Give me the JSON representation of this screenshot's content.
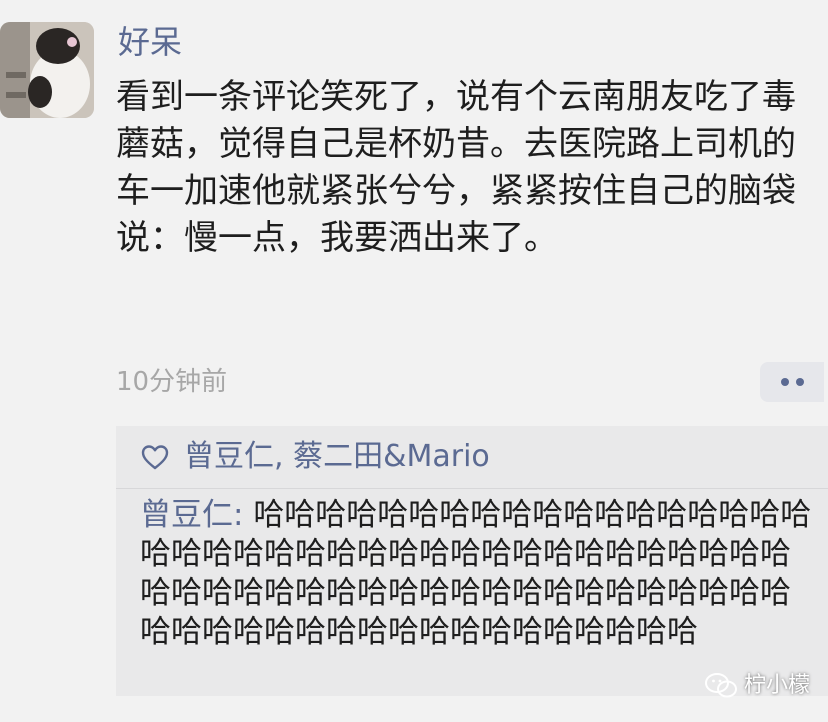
{
  "post": {
    "username": "好呆",
    "text": "看到一条评论笑死了，说有个云南朋友吃了毒蘑菇，觉得自己是杯奶昔。去医院路上司机的车一加速他就紧张兮兮，紧紧按住自己的脑袋说：慢一点，我要洒出来了。",
    "timestamp": "10分钟前",
    "avatar_icon": "cat-avatar",
    "more_icon": "more-dots-icon"
  },
  "interactions": {
    "like_icon": "heart-outline-icon",
    "likers": "曾豆仁, 蔡二田&Mario",
    "comment": {
      "author": "曾豆仁",
      "separator": ": ",
      "text": "哈哈哈哈哈哈哈哈哈哈哈哈哈哈哈哈哈哈哈哈哈哈哈哈哈哈哈哈哈哈哈哈哈哈哈哈哈哈哈哈哈哈哈哈哈哈哈哈哈哈哈哈哈哈哈哈哈哈哈哈哈哈哈哈哈哈哈哈哈哈哈哈哈哈哈哈哈哈"
    }
  },
  "watermark": {
    "icon": "wechat-icon",
    "text": "柠小檬"
  },
  "colors": {
    "background": "#f2f2f2",
    "link_blue": "#5b6a92",
    "body_text": "#1e1e1e",
    "timestamp_gray": "#a7a7a7",
    "comment_box": "#e9e9ea"
  }
}
